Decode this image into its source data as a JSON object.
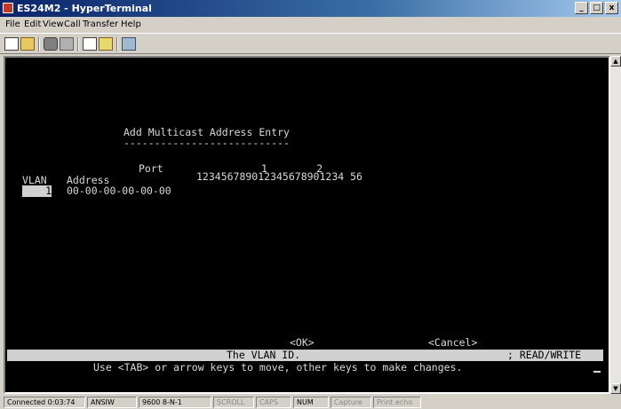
{
  "window": {
    "title": "ES24M2 - HyperTerminal",
    "minimize": "_",
    "maximize": "□",
    "close": "x"
  },
  "menu": {
    "items": [
      "File",
      "Edit",
      "View",
      "Call",
      "Transfer",
      "Help"
    ]
  },
  "toolbar": {
    "icons": [
      "new-file-icon",
      "open-folder-icon",
      "connect-phone-icon",
      "disconnect-icon",
      "send-icon",
      "receive-icon",
      "properties-icon"
    ]
  },
  "terminal": {
    "heading": "Add Multicast Address Entry",
    "underline": "---------------------------",
    "port_label": "Port",
    "tens_row": "1        2",
    "col_vlan": "VLAN",
    "col_address": "Address",
    "port_digits": "123456789012345678901234 56",
    "entry": {
      "vlan": "1",
      "address": "00-00-00-00-00-00"
    },
    "ok_button": "<OK>",
    "cancel_button": "<Cancel>",
    "status_message": "The VLAN ID.",
    "access_mode": "READ/WRITE",
    "help_line": "Use <TAB> or arrow keys to move, other keys to make changes."
  },
  "statusbar": {
    "cells": [
      "Connected 0:03:74",
      "ANSIW",
      "9600 8-N-1",
      "SCROLL",
      "CAPS",
      "NUM",
      "Capture",
      "Print echo"
    ]
  }
}
